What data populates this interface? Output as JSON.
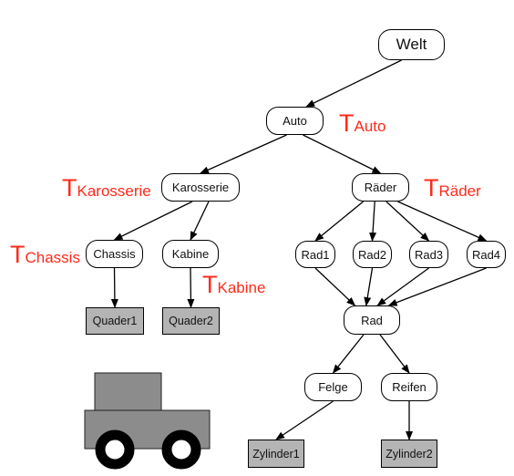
{
  "diagram": {
    "nodes": {
      "welt": "Welt",
      "auto": "Auto",
      "karosserie": "Karosserie",
      "raeder": "Räder",
      "chassis": "Chassis",
      "kabine": "Kabine",
      "rad1": "Rad1",
      "rad2": "Rad2",
      "rad3": "Rad3",
      "rad4": "Rad4",
      "rad": "Rad",
      "quader1": "Quader1",
      "quader2": "Quader2",
      "felge": "Felge",
      "reifen": "Reifen",
      "zylinder1": "Zylinder1",
      "zylinder2": "Zylinder2"
    },
    "transforms": {
      "auto": {
        "t": "T",
        "sub": "Auto"
      },
      "karosserie": {
        "t": "T",
        "sub": "Karosserie"
      },
      "raeder": {
        "t": "T",
        "sub": "Räder"
      },
      "chassis": {
        "t": "T",
        "sub": "Chassis"
      },
      "kabine": {
        "t": "T",
        "sub": "Kabine"
      }
    },
    "edges": [
      [
        "welt",
        "auto"
      ],
      [
        "auto",
        "karosserie"
      ],
      [
        "auto",
        "raeder"
      ],
      [
        "karosserie",
        "chassis"
      ],
      [
        "karosserie",
        "kabine"
      ],
      [
        "chassis",
        "quader1"
      ],
      [
        "kabine",
        "quader2"
      ],
      [
        "raeder",
        "rad1"
      ],
      [
        "raeder",
        "rad2"
      ],
      [
        "raeder",
        "rad3"
      ],
      [
        "raeder",
        "rad4"
      ],
      [
        "rad1",
        "rad"
      ],
      [
        "rad2",
        "rad"
      ],
      [
        "rad3",
        "rad"
      ],
      [
        "rad4",
        "rad"
      ],
      [
        "rad",
        "felge"
      ],
      [
        "rad",
        "reifen"
      ],
      [
        "felge",
        "zylinder1"
      ],
      [
        "reifen",
        "zylinder2"
      ]
    ],
    "colors": {
      "transform_label": "#ff2a1a",
      "geometry_fill": "#b4b4b4",
      "car_body": "#8c8c8c",
      "wheel": "#000000"
    }
  }
}
